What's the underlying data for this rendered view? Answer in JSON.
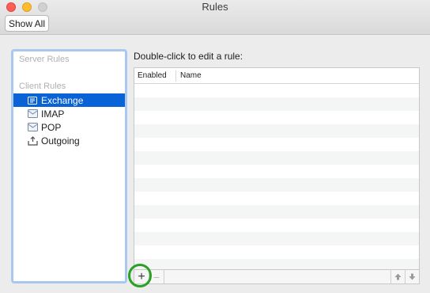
{
  "window": {
    "title": "Rules"
  },
  "toolbar": {
    "show_all_label": "Show All"
  },
  "sidebar": {
    "server_rules_header": "Server Rules",
    "client_rules_header": "Client Rules",
    "items": [
      {
        "label": "Exchange",
        "icon": "exchange-icon",
        "selected": true
      },
      {
        "label": "IMAP",
        "icon": "imap-account-icon",
        "selected": false
      },
      {
        "label": "POP",
        "icon": "pop-account-icon",
        "selected": false
      },
      {
        "label": "Outgoing",
        "icon": "outgoing-icon",
        "selected": false
      }
    ]
  },
  "main": {
    "instruction": "Double-click to edit a rule:",
    "columns": [
      "Enabled",
      "Name"
    ],
    "rows": []
  },
  "bottom_bar": {
    "add_label": "+",
    "remove_label": "−"
  },
  "colors": {
    "selection": "#0a63d6",
    "highlight_ring": "#2aa024",
    "focus_ring": "#a9c8ef"
  }
}
